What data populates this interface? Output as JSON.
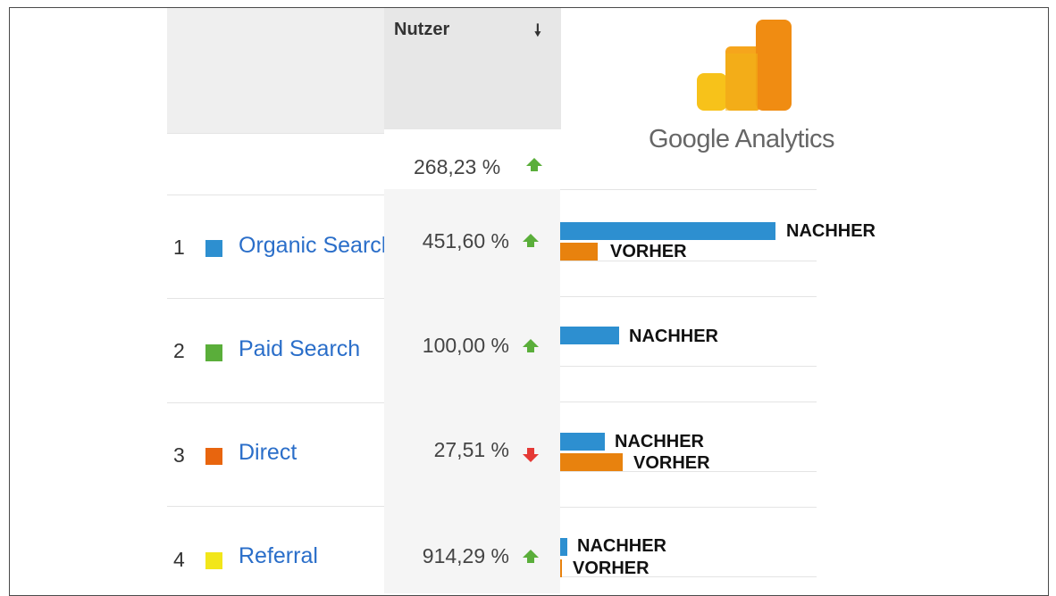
{
  "header": {
    "users_title": "Nutzer",
    "sort_icon": "arrow-down-icon"
  },
  "total": {
    "value": "268,23 %",
    "trend": "up"
  },
  "rows": [
    {
      "rank": "1",
      "channel": "Organic Search",
      "change": "451,60 %",
      "trend": "up",
      "color": "#2d8fd0",
      "after_label": "NACHHER",
      "before_label": "VORHER",
      "after_rel": 0.26,
      "before_rel": 0.05
    },
    {
      "rank": "2",
      "channel": "Paid Search",
      "change": "100,00 %",
      "trend": "up",
      "color": "#5aae3a",
      "after_label": "NACHHER",
      "before_label": "",
      "after_rel": 0.07,
      "before_rel": 0
    },
    {
      "rank": "3",
      "channel": "Direct",
      "change": "27,51 %",
      "trend": "down",
      "color": "#e8650e",
      "after_label": "NACHHER",
      "before_label": "VORHER",
      "after_rel": 0.055,
      "before_rel": 0.075
    },
    {
      "rank": "4",
      "channel": "Referral",
      "change": "914,29 %",
      "trend": "up",
      "color": "#f2e61a",
      "after_label": "NACHHER",
      "before_label": "VORHER",
      "after_rel": 0.01,
      "before_rel": 0.002
    }
  ],
  "logo": {
    "text": "Google Analytics",
    "icon": "google-analytics-logo"
  },
  "colors": {
    "up": "#5aae3a",
    "down": "#e53935",
    "link": "#2a6ec9",
    "after_bar": "#2d8fd0",
    "before_bar": "#e8820e"
  }
}
